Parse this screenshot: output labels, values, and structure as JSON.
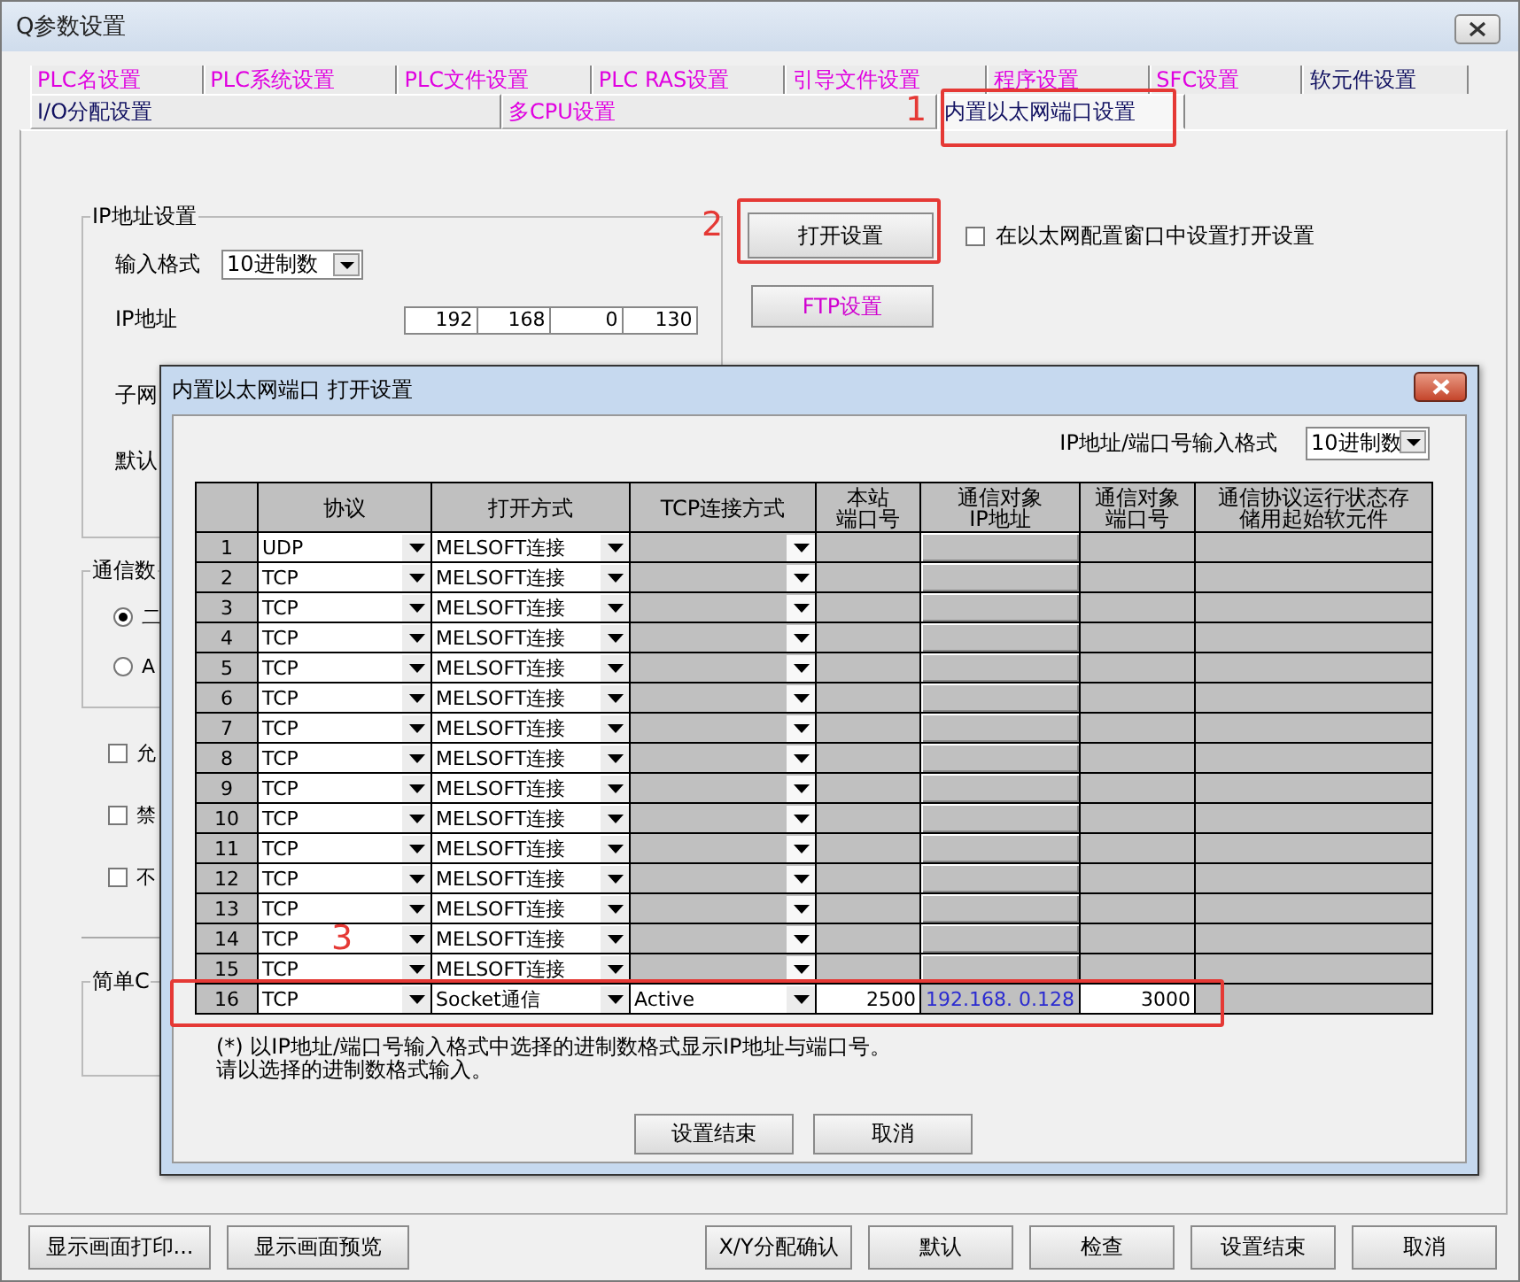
{
  "window": {
    "title": "Q参数设置"
  },
  "tab_rows": [
    [
      {
        "label": "PLC名设置",
        "color": "#e000e0",
        "selected": false
      },
      {
        "label": "PLC系统设置",
        "color": "#e000e0",
        "selected": false
      },
      {
        "label": "PLC文件设置",
        "color": "#e000e0",
        "selected": false
      },
      {
        "label": "PLC RAS设置",
        "color": "#e000e0",
        "selected": false
      },
      {
        "label": "引导文件设置",
        "color": "#e000e0",
        "selected": false
      },
      {
        "label": "程序设置",
        "color": "#e000e0",
        "selected": false
      },
      {
        "label": "SFC设置",
        "color": "#e000e0",
        "selected": false
      },
      {
        "label": "软元件设置",
        "color": "#101060",
        "selected": false
      }
    ],
    [
      {
        "label": "I/O分配设置",
        "color": "#101060",
        "selected": false
      },
      {
        "label": "多CPU设置",
        "color": "#e000e0",
        "selected": false
      },
      {
        "label": "内置以太网端口设置",
        "color": "#101060",
        "selected": true
      }
    ]
  ],
  "ip_settings": {
    "title": "IP地址设置",
    "input_format_label": "输入格式",
    "input_format": "10进制数",
    "ip_label": "IP地址",
    "ip": [
      "192",
      "168",
      "0",
      "130"
    ],
    "subnet_label": "子网",
    "gateway_label": "默认"
  },
  "open_settings_button": "打开设置",
  "config_checkbox": {
    "label": "在以太网配置窗口中设置打开设置",
    "checked": false
  },
  "ftp_button": "FTP设置",
  "comm_group": {
    "title": "通信数",
    "radios": [
      {
        "label": "二",
        "selected": true
      },
      {
        "label": "A",
        "selected": false
      }
    ]
  },
  "checkboxes": [
    {
      "label": "允",
      "checked": false
    },
    {
      "label": "禁",
      "checked": false
    },
    {
      "label": "不",
      "checked": false
    }
  ],
  "simple_group": {
    "title": "简单C"
  },
  "bottom_buttons": [
    "显示画面打印...",
    "显示画面预览",
    "X/Y分配确认",
    "默认",
    "检查",
    "设置结束",
    "取消"
  ],
  "dialog": {
    "title": "内置以太网端口 打开设置",
    "format_label": "IP地址/端口号输入格式",
    "format_value": "10进制数",
    "columns": [
      "协议",
      "打开方式",
      "TCP连接方式",
      "本站端口号",
      "通信对象IP地址",
      "通信对象端口号",
      "通信协议运行状态存储用起始软元件"
    ],
    "rows": [
      {
        "no": "1",
        "protocol": "UDP",
        "open_method": "MELSOFT连接",
        "enabled": false
      },
      {
        "no": "2",
        "protocol": "TCP",
        "open_method": "MELSOFT连接",
        "enabled": false
      },
      {
        "no": "3",
        "protocol": "TCP",
        "open_method": "MELSOFT连接",
        "enabled": false
      },
      {
        "no": "4",
        "protocol": "TCP",
        "open_method": "MELSOFT连接",
        "enabled": false
      },
      {
        "no": "5",
        "protocol": "TCP",
        "open_method": "MELSOFT连接",
        "enabled": false
      },
      {
        "no": "6",
        "protocol": "TCP",
        "open_method": "MELSOFT连接",
        "enabled": false
      },
      {
        "no": "7",
        "protocol": "TCP",
        "open_method": "MELSOFT连接",
        "enabled": false
      },
      {
        "no": "8",
        "protocol": "TCP",
        "open_method": "MELSOFT连接",
        "enabled": false
      },
      {
        "no": "9",
        "protocol": "TCP",
        "open_method": "MELSOFT连接",
        "enabled": false
      },
      {
        "no": "10",
        "protocol": "TCP",
        "open_method": "MELSOFT连接",
        "enabled": false
      },
      {
        "no": "11",
        "protocol": "TCP",
        "open_method": "MELSOFT连接",
        "enabled": false
      },
      {
        "no": "12",
        "protocol": "TCP",
        "open_method": "MELSOFT连接",
        "enabled": false
      },
      {
        "no": "13",
        "protocol": "TCP",
        "open_method": "MELSOFT连接",
        "enabled": false
      },
      {
        "no": "14",
        "protocol": "TCP",
        "open_method": "MELSOFT连接",
        "enabled": false
      },
      {
        "no": "15",
        "protocol": "TCP",
        "open_method": "MELSOFT连接",
        "enabled": false
      },
      {
        "no": "16",
        "protocol": "TCP",
        "open_method": "Socket通信",
        "tcp_mode": "Active",
        "local_port": "2500",
        "remote_ip": "192.168. 0.128",
        "remote_port": "3000",
        "enabled": true
      }
    ],
    "note": [
      "(*) 以IP地址/端口号输入格式中选择的进制数格式显示IP地址与端口号。",
      "请以选择的进制数格式输入。"
    ],
    "buttons": [
      "设置结束",
      "取消"
    ]
  },
  "annotations": [
    {
      "label": "1"
    },
    {
      "label": "2"
    },
    {
      "label": "3"
    }
  ]
}
